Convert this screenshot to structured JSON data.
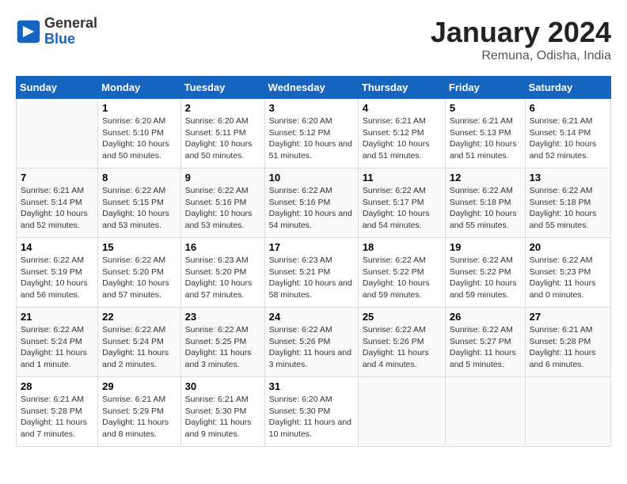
{
  "header": {
    "logo": {
      "line1": "General",
      "line2": "Blue"
    },
    "title": "January 2024",
    "location": "Remuna, Odisha, India"
  },
  "weekdays": [
    "Sunday",
    "Monday",
    "Tuesday",
    "Wednesday",
    "Thursday",
    "Friday",
    "Saturday"
  ],
  "weeks": [
    [
      null,
      {
        "day": "1",
        "sunrise": "6:20 AM",
        "sunset": "5:10 PM",
        "daylight": "10 hours and 50 minutes."
      },
      {
        "day": "2",
        "sunrise": "6:20 AM",
        "sunset": "5:11 PM",
        "daylight": "10 hours and 50 minutes."
      },
      {
        "day": "3",
        "sunrise": "6:20 AM",
        "sunset": "5:12 PM",
        "daylight": "10 hours and 51 minutes."
      },
      {
        "day": "4",
        "sunrise": "6:21 AM",
        "sunset": "5:12 PM",
        "daylight": "10 hours and 51 minutes."
      },
      {
        "day": "5",
        "sunrise": "6:21 AM",
        "sunset": "5:13 PM",
        "daylight": "10 hours and 51 minutes."
      },
      {
        "day": "6",
        "sunrise": "6:21 AM",
        "sunset": "5:14 PM",
        "daylight": "10 hours and 52 minutes."
      }
    ],
    [
      {
        "day": "7",
        "sunrise": "6:21 AM",
        "sunset": "5:14 PM",
        "daylight": "10 hours and 52 minutes."
      },
      {
        "day": "8",
        "sunrise": "6:22 AM",
        "sunset": "5:15 PM",
        "daylight": "10 hours and 53 minutes."
      },
      {
        "day": "9",
        "sunrise": "6:22 AM",
        "sunset": "5:16 PM",
        "daylight": "10 hours and 53 minutes."
      },
      {
        "day": "10",
        "sunrise": "6:22 AM",
        "sunset": "5:16 PM",
        "daylight": "10 hours and 54 minutes."
      },
      {
        "day": "11",
        "sunrise": "6:22 AM",
        "sunset": "5:17 PM",
        "daylight": "10 hours and 54 minutes."
      },
      {
        "day": "12",
        "sunrise": "6:22 AM",
        "sunset": "5:18 PM",
        "daylight": "10 hours and 55 minutes."
      },
      {
        "day": "13",
        "sunrise": "6:22 AM",
        "sunset": "5:18 PM",
        "daylight": "10 hours and 55 minutes."
      }
    ],
    [
      {
        "day": "14",
        "sunrise": "6:22 AM",
        "sunset": "5:19 PM",
        "daylight": "10 hours and 56 minutes."
      },
      {
        "day": "15",
        "sunrise": "6:22 AM",
        "sunset": "5:20 PM",
        "daylight": "10 hours and 57 minutes."
      },
      {
        "day": "16",
        "sunrise": "6:23 AM",
        "sunset": "5:20 PM",
        "daylight": "10 hours and 57 minutes."
      },
      {
        "day": "17",
        "sunrise": "6:23 AM",
        "sunset": "5:21 PM",
        "daylight": "10 hours and 58 minutes."
      },
      {
        "day": "18",
        "sunrise": "6:22 AM",
        "sunset": "5:22 PM",
        "daylight": "10 hours and 59 minutes."
      },
      {
        "day": "19",
        "sunrise": "6:22 AM",
        "sunset": "5:22 PM",
        "daylight": "10 hours and 59 minutes."
      },
      {
        "day": "20",
        "sunrise": "6:22 AM",
        "sunset": "5:23 PM",
        "daylight": "11 hours and 0 minutes."
      }
    ],
    [
      {
        "day": "21",
        "sunrise": "6:22 AM",
        "sunset": "5:24 PM",
        "daylight": "11 hours and 1 minute."
      },
      {
        "day": "22",
        "sunrise": "6:22 AM",
        "sunset": "5:24 PM",
        "daylight": "11 hours and 2 minutes."
      },
      {
        "day": "23",
        "sunrise": "6:22 AM",
        "sunset": "5:25 PM",
        "daylight": "11 hours and 3 minutes."
      },
      {
        "day": "24",
        "sunrise": "6:22 AM",
        "sunset": "5:26 PM",
        "daylight": "11 hours and 3 minutes."
      },
      {
        "day": "25",
        "sunrise": "6:22 AM",
        "sunset": "5:26 PM",
        "daylight": "11 hours and 4 minutes."
      },
      {
        "day": "26",
        "sunrise": "6:22 AM",
        "sunset": "5:27 PM",
        "daylight": "11 hours and 5 minutes."
      },
      {
        "day": "27",
        "sunrise": "6:21 AM",
        "sunset": "5:28 PM",
        "daylight": "11 hours and 6 minutes."
      }
    ],
    [
      {
        "day": "28",
        "sunrise": "6:21 AM",
        "sunset": "5:28 PM",
        "daylight": "11 hours and 7 minutes."
      },
      {
        "day": "29",
        "sunrise": "6:21 AM",
        "sunset": "5:29 PM",
        "daylight": "11 hours and 8 minutes."
      },
      {
        "day": "30",
        "sunrise": "6:21 AM",
        "sunset": "5:30 PM",
        "daylight": "11 hours and 9 minutes."
      },
      {
        "day": "31",
        "sunrise": "6:20 AM",
        "sunset": "5:30 PM",
        "daylight": "11 hours and 10 minutes."
      },
      null,
      null,
      null
    ]
  ]
}
